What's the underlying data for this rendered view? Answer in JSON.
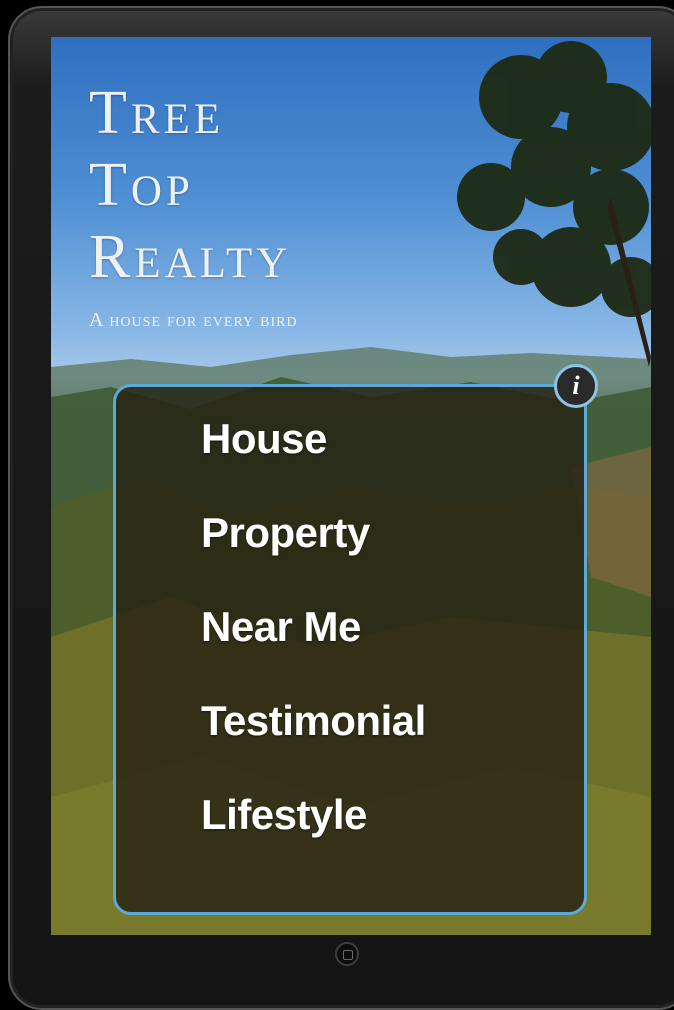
{
  "brand": {
    "title_lines": [
      "Tree",
      "Top",
      "Realty"
    ],
    "tagline": "A house for every bird"
  },
  "info_button": {
    "icon": "info-icon",
    "glyph": "i"
  },
  "menu": {
    "items": [
      "House",
      "Property",
      "Near Me",
      "Testimonial",
      "Lifestyle"
    ]
  },
  "device": {
    "home_button_icon": "home-button-icon"
  },
  "colors": {
    "panel_border": "#5aa9d6",
    "panel_background": "#262214",
    "menu_text": "#ffffff",
    "sky": "#4f8fd4"
  }
}
